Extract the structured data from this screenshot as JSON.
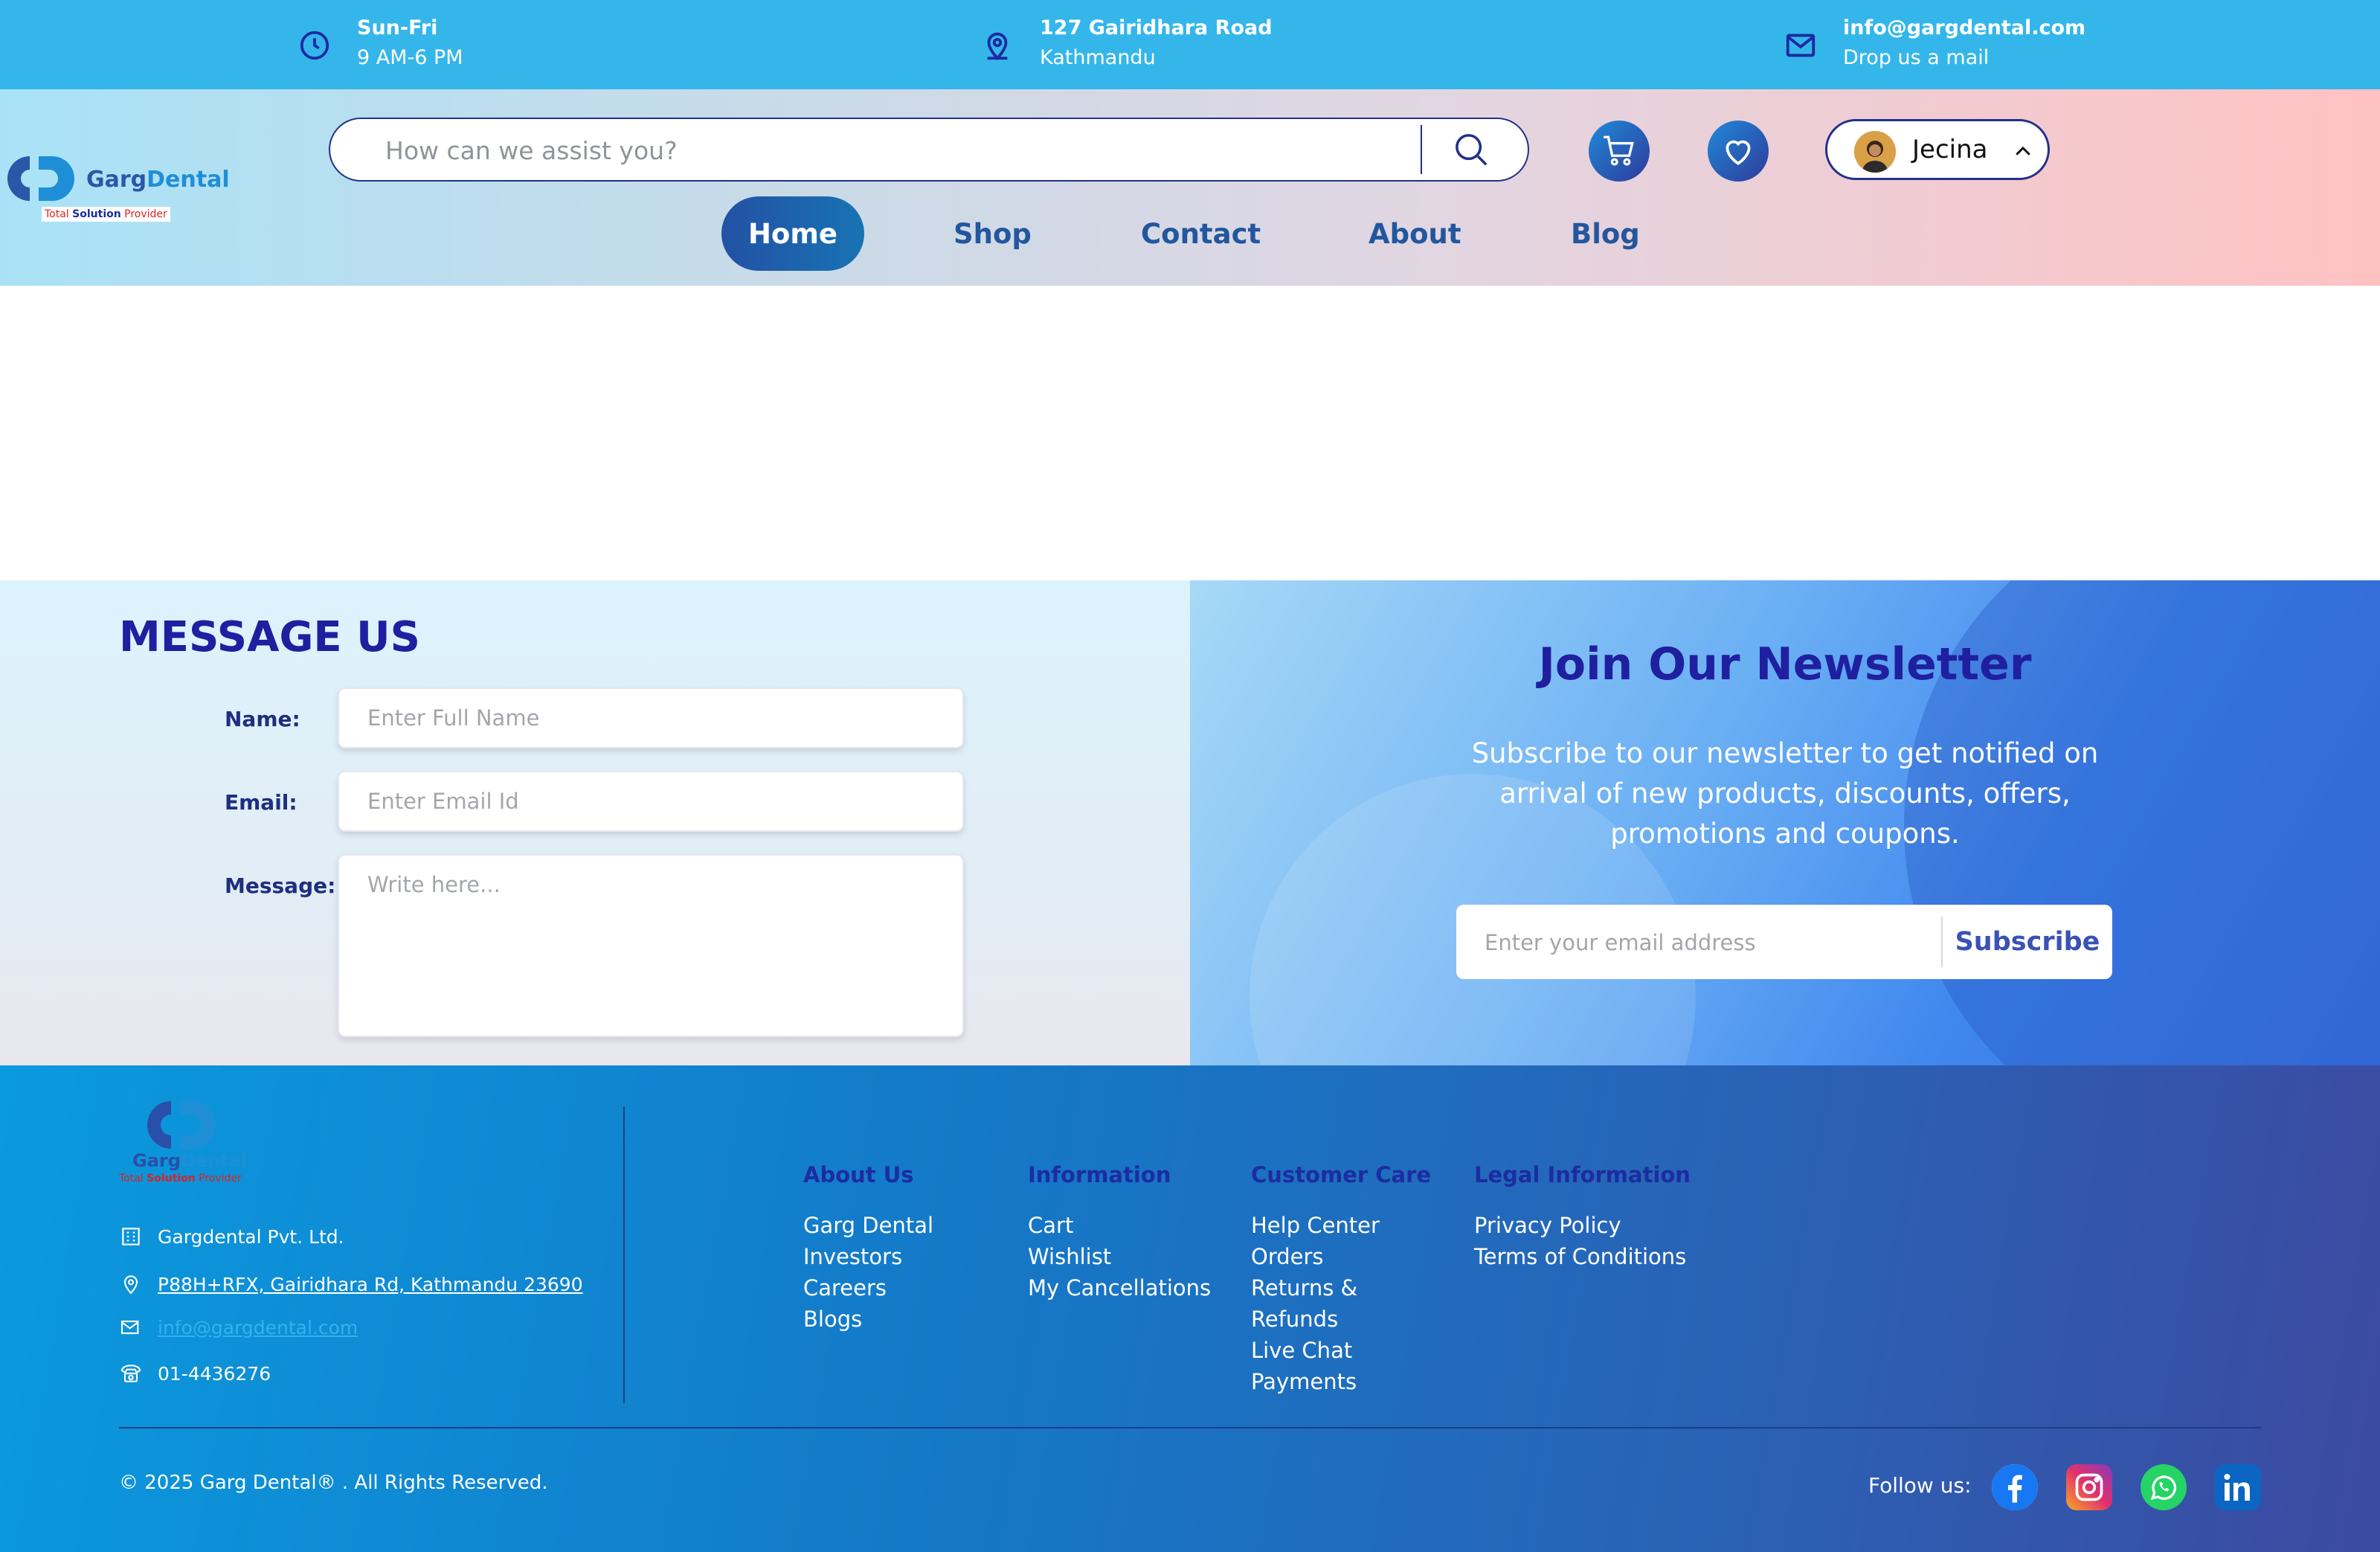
{
  "topbar": {
    "hours": {
      "title": "Sun-Fri",
      "sub": "9 AM-6 PM"
    },
    "address": {
      "title": "127 Gairidhara Road",
      "sub": "Kathmandu"
    },
    "email": {
      "title": "info@gargdental.com",
      "sub": "Drop us a mail"
    }
  },
  "brand": {
    "name_a": "Garg",
    "name_b": "Dental",
    "tagline_a": "Total ",
    "tagline_b": "Solution",
    "tagline_c": " Provider"
  },
  "search": {
    "placeholder": "How can we assist you?"
  },
  "user": {
    "name": "Jecina"
  },
  "nav": {
    "home": "Home",
    "shop": "Shop",
    "contact": "Contact",
    "about": "About",
    "blog": "Blog"
  },
  "message": {
    "title": "MESSAGE US",
    "name_label": "Name:",
    "name_placeholder": "Enter Full Name",
    "email_label": "Email:",
    "email_placeholder": "Enter Email Id",
    "message_label": "Message:",
    "message_placeholder": "Write here..."
  },
  "newsletter": {
    "title": "Join Our Newsletter",
    "text": "Subscribe to our newsletter to get notified on arrival of new products, discounts, offers, promotions and coupons.",
    "placeholder": "Enter your email address",
    "button": "Subscribe"
  },
  "footer": {
    "company": "Gargdental Pvt. Ltd.",
    "address": "P88H+RFX, Gairidhara Rd, Kathmandu 23690",
    "email": "info@gargdental.com",
    "phone": "01-4436276",
    "columns": [
      {
        "title": "About Us",
        "links": [
          "Garg Dental",
          "Investors",
          "Careers",
          "Blogs"
        ]
      },
      {
        "title": "Information",
        "links": [
          "Cart",
          "Wishlist",
          "My Cancellations"
        ]
      },
      {
        "title": "Customer Care",
        "links": [
          "Help Center",
          "Orders",
          "Returns &",
          "Refunds",
          "Live Chat",
          "Payments"
        ]
      },
      {
        "title": "Legal Information",
        "links": [
          "Privacy Policy",
          "Terms of Conditions"
        ]
      }
    ],
    "copyright": "© 2025 Garg Dental® . All Rights Reserved.",
    "follow": "Follow us:"
  },
  "colors": {
    "topbar": "#34b6ea",
    "accent_dark": "#1f1fa0",
    "nav_active": "#2351a5",
    "footer": "#1479c8"
  },
  "icons": [
    "clock-icon",
    "location-icon",
    "mail-icon",
    "search-icon",
    "cart-icon",
    "heart-icon",
    "chevron-up-icon",
    "building-icon",
    "envelope-icon",
    "phone-icon",
    "facebook-icon",
    "instagram-icon",
    "whatsapp-icon",
    "linkedin-icon"
  ]
}
